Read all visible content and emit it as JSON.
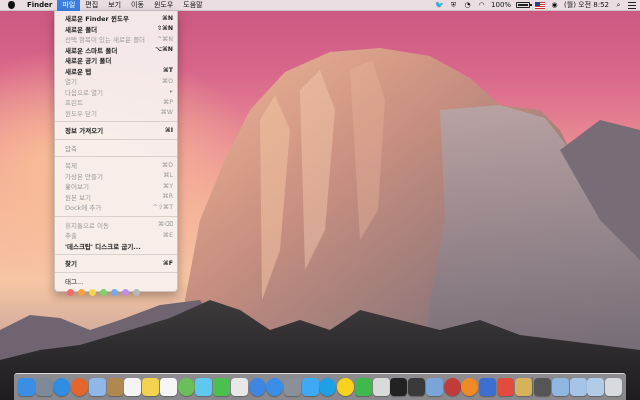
{
  "menubar": {
    "app_name": "Finder",
    "menus": [
      {
        "label": "파일"
      },
      {
        "label": "편집"
      },
      {
        "label": "보기"
      },
      {
        "label": "이동"
      },
      {
        "label": "윈도우"
      },
      {
        "label": "도움말"
      }
    ],
    "battery_percent": "100%",
    "clock": "(월) 오전 8:52",
    "status_icons": [
      "twitter-icon",
      "vpn-icon",
      "wifi-icon",
      "battery-icon",
      "flag-icon",
      "user-icon",
      "spotlight-icon",
      "notification-list-icon"
    ]
  },
  "file_menu": {
    "items": [
      {
        "label": "새로운 Finder 윈도우",
        "shortcut": "⌘N",
        "bold": true
      },
      {
        "label": "새로운 폴더",
        "shortcut": "⇧⌘N",
        "bold": true
      },
      {
        "label": "선택 항목이 있는 새로운 폴더",
        "shortcut": "^⌘N",
        "disabled": true
      },
      {
        "label": "새로운 스마트 폴더",
        "shortcut": "⌥⌘N",
        "bold": true
      },
      {
        "label": "새로운 공기 폴더",
        "shortcut": "",
        "bold": true
      },
      {
        "label": "새로운 탭",
        "shortcut": "⌘T",
        "bold": true
      },
      {
        "label": "열기",
        "shortcut": "⌘O",
        "disabled": true
      },
      {
        "label": "다음으로 열기",
        "shortcut": "▸",
        "disabled": true
      },
      {
        "label": "프린트",
        "shortcut": "⌘P",
        "disabled": true
      },
      {
        "label": "윈도우 닫기",
        "shortcut": "⌘W",
        "disabled": true
      },
      {
        "label": "정보 가져오기",
        "shortcut": "⌘I",
        "bold": true
      },
      {
        "label": "압축",
        "shortcut": "",
        "disabled": true
      },
      {
        "label": "복제",
        "shortcut": "⌘D",
        "disabled": true
      },
      {
        "label": "가상본 만들기",
        "shortcut": "⌘L",
        "disabled": true
      },
      {
        "label": "훑어보기",
        "shortcut": "⌘Y",
        "disabled": true
      },
      {
        "label": "원본 보기",
        "shortcut": "⌘R",
        "disabled": true
      },
      {
        "label": "Dock에 추가",
        "shortcut": "^⇧⌘T",
        "disabled": true
      },
      {
        "label": "휴지통으로 이동",
        "shortcut": "⌘⌫",
        "disabled": true
      },
      {
        "label": "추출",
        "shortcut": "⌘E",
        "disabled": true
      },
      {
        "label": "'데스크탑' 디스크로 굽기...",
        "shortcut": "",
        "bold": true
      },
      {
        "label": "찾기",
        "shortcut": "⌘F",
        "bold": true
      },
      {
        "label": "태그...",
        "shortcut": "",
        "bold": false
      }
    ],
    "tag_colors": [
      "#f36b6b",
      "#f5a142",
      "#f2d64b",
      "#7dd36a",
      "#7aa8f0",
      "#c08ee0",
      "#b8b8b8"
    ]
  },
  "dock": {
    "apps": [
      {
        "name": "finder-icon",
        "color": "#3a8ee6"
      },
      {
        "name": "launchpad-icon",
        "color": "#7f8a99"
      },
      {
        "name": "safari-icon",
        "color": "#2f8de4"
      },
      {
        "name": "firefox-icon",
        "color": "#e5662c"
      },
      {
        "name": "mail-icon",
        "color": "#8fb7e8"
      },
      {
        "name": "contacts-icon",
        "color": "#b0884f"
      },
      {
        "name": "calendar-icon",
        "color": "#f4f4f4"
      },
      {
        "name": "notes-icon",
        "color": "#f2d24f"
      },
      {
        "name": "reminders-icon",
        "color": "#f5f5f5"
      },
      {
        "name": "maps-icon",
        "color": "#6bbf5b"
      },
      {
        "name": "messages-icon",
        "color": "#5ec8f0"
      },
      {
        "name": "facetime-icon",
        "color": "#4ac04e"
      },
      {
        "name": "photos-icon",
        "color": "#e8e8e8"
      },
      {
        "name": "itunes-icon",
        "color": "#3f86e0"
      },
      {
        "name": "app-store-icon",
        "color": "#3a8ee6"
      },
      {
        "name": "settings-icon",
        "color": "#8a8f99"
      },
      {
        "name": "twitter-icon",
        "color": "#3fa9f5"
      },
      {
        "name": "skype-icon",
        "color": "#1fa0e6"
      },
      {
        "name": "kakaotalk-icon",
        "color": "#f7d21e"
      },
      {
        "name": "line-icon",
        "color": "#40b84c"
      },
      {
        "name": "document-icon",
        "color": "#dadada"
      },
      {
        "name": "terminal-icon",
        "color": "#222222"
      },
      {
        "name": "activity-monitor-icon",
        "color": "#3a3a3a"
      },
      {
        "name": "preview-icon",
        "color": "#7aa5d8"
      },
      {
        "name": "photo-booth-icon",
        "color": "#c23b3b"
      },
      {
        "name": "vlc-icon",
        "color": "#f08a24"
      },
      {
        "name": "xcode-icon",
        "color": "#3b6fd0"
      },
      {
        "name": "pages-icon",
        "color": "#e34b3f"
      },
      {
        "name": "archive-utility-icon",
        "color": "#d8b25a"
      }
    ],
    "trailing": [
      {
        "name": "stack-documents-icon",
        "color": "#555555"
      },
      {
        "name": "stack-folder-icon",
        "color": "#8fb6e0"
      },
      {
        "name": "downloads-icon",
        "color": "#a6c4e8"
      },
      {
        "name": "stack-folder-2-icon",
        "color": "#b2cbe6"
      },
      {
        "name": "trash-icon",
        "color": "#d7dbe0"
      }
    ]
  }
}
